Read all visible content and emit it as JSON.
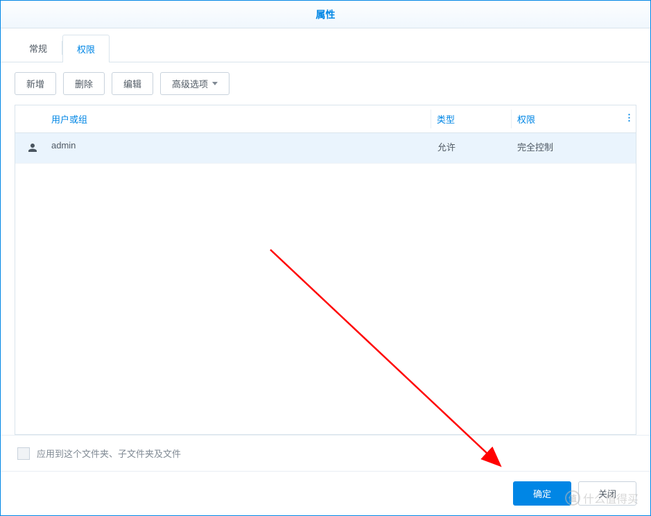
{
  "title": "属性",
  "tabs": {
    "general": "常规",
    "permission": "权限"
  },
  "toolbar": {
    "add": "新增",
    "delete": "删除",
    "edit": "编辑",
    "advanced": "高级选项"
  },
  "table": {
    "headers": {
      "user_or_group": "用户或组",
      "type": "类型",
      "permission": "权限"
    },
    "rows": [
      {
        "user": "admin",
        "type": "允许",
        "permission": "完全控制"
      }
    ]
  },
  "footer": {
    "apply_recursive": "应用到这个文件夹、子文件夹及文件",
    "ok": "确定",
    "close": "关闭"
  },
  "watermark": {
    "badge": "值",
    "text": "什么值得买"
  }
}
